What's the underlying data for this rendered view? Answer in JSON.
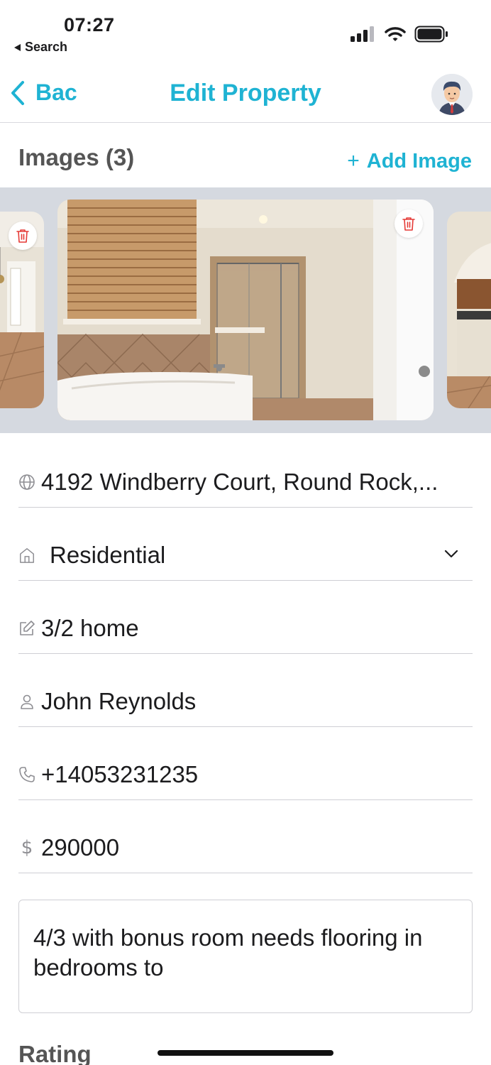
{
  "status_bar": {
    "time": "07:27",
    "back_label": "Search"
  },
  "nav": {
    "back_label": "Bac",
    "title": "Edit Property"
  },
  "images": {
    "title": "Images (3)",
    "add_label": "Add Image"
  },
  "form": {
    "address": "4192 Windberry Court, Round Rock,...",
    "type": "Residential",
    "description": "3/2 home",
    "contact_name": "John Reynolds",
    "phone": "+14053231235",
    "price": "290000",
    "notes": "4/3 with bonus room needs flooring in bedrooms to"
  },
  "rating": {
    "title": "Rating"
  },
  "colors": {
    "accent": "#1fb3d3",
    "delete": "#e53935"
  },
  "icons": [
    "globe-icon",
    "home-icon",
    "edit-icon",
    "person-icon",
    "phone-icon",
    "dollar-icon",
    "trash-icon",
    "chevron-down-icon",
    "chevron-left-icon",
    "plus-icon"
  ]
}
